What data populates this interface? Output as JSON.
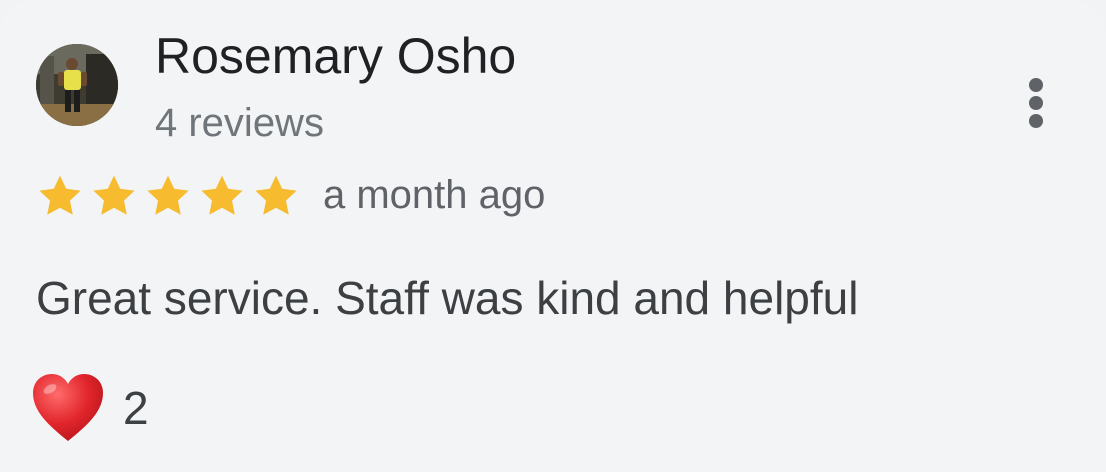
{
  "review": {
    "author_name": "Rosemary Osho",
    "review_count": "4 reviews",
    "rating": 5,
    "rating_max": 5,
    "timestamp": "a month ago",
    "text": "Great service. Staff was kind and helpful",
    "reaction_icon": "red-heart-icon",
    "reaction_count": "2",
    "menu_icon": "more-vert-icon"
  },
  "colors": {
    "background": "#f3f4f6",
    "star": "#f6bb2f",
    "heart": "#e1262c",
    "name_text": "#202124",
    "secondary_text": "#70757a",
    "body_text": "#3c4043"
  }
}
